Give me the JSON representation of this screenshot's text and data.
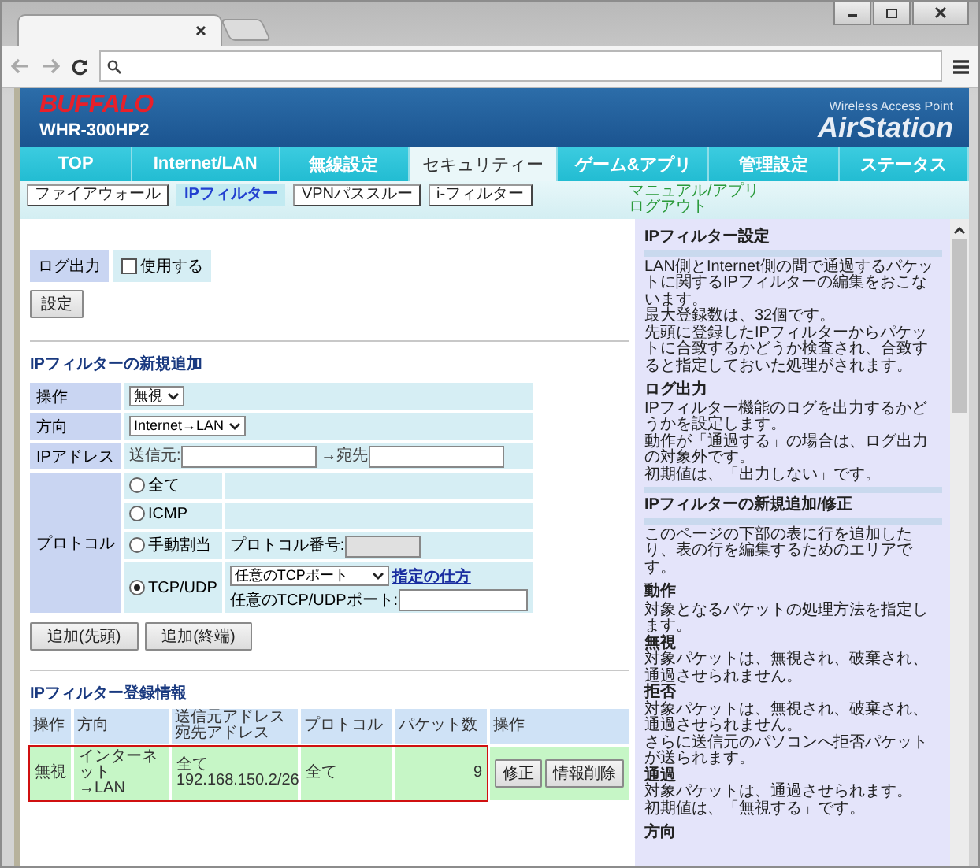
{
  "header": {
    "brand": "BUFFALO",
    "model": "WHR-300HP2",
    "tagline": "Wireless Access Point",
    "product": "AirStation"
  },
  "nav": [
    {
      "label": "TOP",
      "selected": false
    },
    {
      "label": "Internet/LAN",
      "selected": false
    },
    {
      "label": "無線設定",
      "selected": false
    },
    {
      "label": "セキュリティー",
      "selected": true
    },
    {
      "label": "ゲーム&アプリ",
      "selected": false
    },
    {
      "label": "管理設定",
      "selected": false
    },
    {
      "label": "ステータス",
      "selected": false
    }
  ],
  "subnav": [
    {
      "label": "ファイアウォール",
      "selected": false
    },
    {
      "label": "IPフィルター",
      "selected": true
    },
    {
      "label": "VPNパススルー",
      "selected": false
    },
    {
      "label": "i-フィルター",
      "selected": false
    }
  ],
  "top_links": [
    "マニュアル/アプリ",
    "ログアウト"
  ],
  "log_output": {
    "label": "ログ出力",
    "option": "使用する",
    "checked": false,
    "button": "設定"
  },
  "new_filter": {
    "title": "IPフィルターの新規追加",
    "action": {
      "label": "操作",
      "value": "無視"
    },
    "direction": {
      "label": "方向",
      "value": "Internet→LAN"
    },
    "ip": {
      "label": "IPアドレス",
      "source_label": "送信元:",
      "dest_label": "→宛先"
    },
    "protocol": {
      "label": "プロトコル",
      "options": [
        {
          "label": "全て",
          "selected": false,
          "kind": "plain"
        },
        {
          "label": "ICMP",
          "selected": false,
          "kind": "plain"
        },
        {
          "label": "手動割当",
          "selected": false,
          "kind": "number",
          "field_label": "プロトコル番号:"
        },
        {
          "label": "TCP/UDP",
          "selected": true,
          "kind": "port",
          "select_value": "任意のTCPポート",
          "link": "指定の仕方",
          "field_label": "任意のTCP/UDPポート:"
        }
      ]
    },
    "buttons": [
      "追加(先頭)",
      "追加(終端)"
    ]
  },
  "registered": {
    "title": "IPフィルター登録情報",
    "columns": [
      "操作",
      "方向",
      "送信元アドレス宛先アドレス",
      "プロトコル",
      "パケット数",
      "操作"
    ],
    "rows": [
      {
        "highlighted": true,
        "cells": [
          [
            "無視"
          ],
          [
            "インターネット",
            "→LAN"
          ],
          [
            "全て",
            "192.168.150.2/26"
          ],
          [
            "全て"
          ],
          [
            "9"
          ]
        ],
        "buttons": [
          "修正",
          "情報削除"
        ]
      }
    ]
  },
  "help": [
    {
      "kind": "title",
      "text": "IPフィルター設定"
    },
    {
      "kind": "text",
      "text": "LAN側とInternet側の間で通過するパケットに関するIPフィルターの編集をおこないます。"
    },
    {
      "kind": "text",
      "text": "最大登録数は、32個です。"
    },
    {
      "kind": "text",
      "text": "先頭に登録したIPフィルターからパケットに合致するかどうか検査され、合致すると指定しておいた処理がされます。"
    },
    {
      "kind": "heading",
      "text": "ログ出力"
    },
    {
      "kind": "text",
      "text": "IPフィルター機能のログを出力するかどうかを設定します。"
    },
    {
      "kind": "text",
      "text": "動作が「通過する」の場合は、ログ出力の対象外です。"
    },
    {
      "kind": "text",
      "text": "初期値は、「出力しない」です。"
    },
    {
      "kind": "title",
      "text": "IPフィルターの新規追加/修正"
    },
    {
      "kind": "text",
      "text": "このページの下部の表に行を追加したり、表の行を編集するためのエリアです。"
    },
    {
      "kind": "heading",
      "text": "動作"
    },
    {
      "kind": "text",
      "text": "対象となるパケットの処理方法を指定します。"
    },
    {
      "kind": "subheading",
      "text": "無視"
    },
    {
      "kind": "text",
      "text": "対象パケットは、無視され、破棄され、通過させられません。"
    },
    {
      "kind": "subheading",
      "text": "拒否"
    },
    {
      "kind": "text",
      "text": "対象パケットは、無視され、破棄され、通過させられません。"
    },
    {
      "kind": "text",
      "text": "さらに送信元のパソコンへ拒否パケットが送られます。"
    },
    {
      "kind": "subheading",
      "text": "通過"
    },
    {
      "kind": "text",
      "text": "対象パケットは、通過させられます。"
    },
    {
      "kind": "text",
      "text": "初期値は、「無視する」です。"
    },
    {
      "kind": "heading",
      "text": "方向"
    }
  ]
}
